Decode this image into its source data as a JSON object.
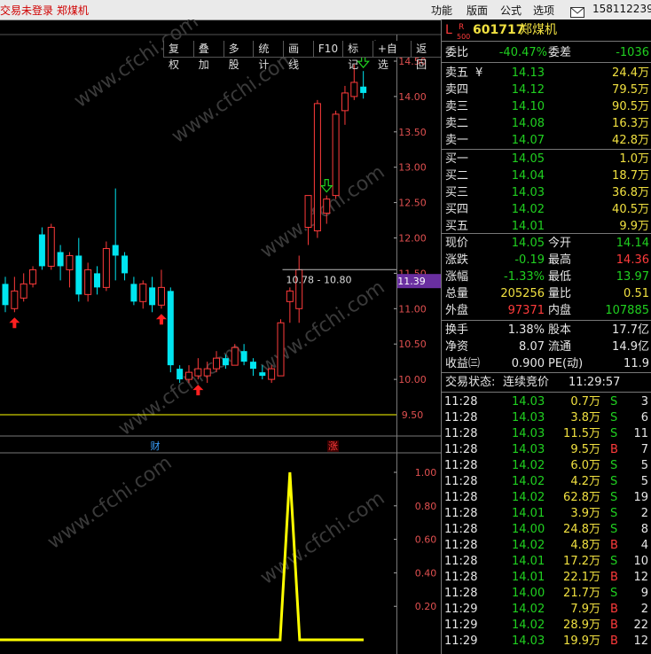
{
  "window": {
    "title": "交易未登录  郑煤机",
    "menu": [
      "功能",
      "版面",
      "公式",
      "选项"
    ],
    "mail_icon": "mail-icon",
    "account": "158112239"
  },
  "toolbar": [
    "复权",
    "叠加",
    "多股",
    "统计",
    "画线",
    "F10",
    "标记",
    "+自选",
    "返回"
  ],
  "chart": {
    "watermark": "www.cfchi.com",
    "price_axis": [
      "14.50",
      "14.00",
      "13.50",
      "13.00",
      "12.50",
      "12.00",
      "11.50",
      "11.00",
      "10.50",
      "10.00",
      "9.50"
    ],
    "current_price_tag": "11.39",
    "range_label": "10.78 - 10.80",
    "markers": [
      "财",
      "涨"
    ],
    "indicator_axis": [
      "1.00",
      "0.80",
      "0.60",
      "0.40",
      "0.20"
    ],
    "colors": {
      "up": "#ff3b3b",
      "down": "#00e5f0",
      "signal_up": "#ff2020",
      "signal_down": "#20d020",
      "line": "#ffff00",
      "level": "#ffff00"
    }
  },
  "stock": {
    "prefix": "L",
    "badge_top": "R",
    "badge_bottom": "500",
    "code": "601717",
    "name": "郑煤机"
  },
  "quote": {
    "weibi_label": "委比",
    "weibi": "-40.47%",
    "weicha_label": "委差",
    "weicha": "-1036",
    "asks": [
      {
        "label": "卖五",
        "flag": "¥",
        "price": "14.13",
        "vol": "24.4万"
      },
      {
        "label": "卖四",
        "flag": "",
        "price": "14.12",
        "vol": "79.5万"
      },
      {
        "label": "卖三",
        "flag": "",
        "price": "14.10",
        "vol": "90.5万"
      },
      {
        "label": "卖二",
        "flag": "",
        "price": "14.08",
        "vol": "16.3万"
      },
      {
        "label": "卖一",
        "flag": "",
        "price": "14.07",
        "vol": "42.8万"
      }
    ],
    "bids": [
      {
        "label": "买一",
        "price": "14.05",
        "vol": "1.0万"
      },
      {
        "label": "买二",
        "price": "14.04",
        "vol": "18.7万"
      },
      {
        "label": "买三",
        "price": "14.03",
        "vol": "36.8万"
      },
      {
        "label": "买四",
        "price": "14.02",
        "vol": "40.5万"
      },
      {
        "label": "买五",
        "price": "14.01",
        "vol": "9.9万"
      }
    ],
    "stats": [
      {
        "l1": "现价",
        "v1": "14.05",
        "c1": "green",
        "l2": "今开",
        "v2": "14.14",
        "c2": "green"
      },
      {
        "l1": "涨跌",
        "v1": "-0.19",
        "c1": "green",
        "l2": "最高",
        "v2": "14.36",
        "c2": "red"
      },
      {
        "l1": "涨幅",
        "v1": "-1.33%",
        "c1": "green",
        "l2": "最低",
        "v2": "13.97",
        "c2": "green"
      },
      {
        "l1": "总量",
        "v1": "205256",
        "c1": "yellow",
        "l2": "量比",
        "v2": "0.51",
        "c2": "yellow"
      },
      {
        "l1": "外盘",
        "v1": "97371",
        "c1": "red",
        "l2": "内盘",
        "v2": "107885",
        "c2": "green"
      }
    ],
    "fin": [
      {
        "l1": "换手",
        "v1": "1.38%",
        "l2": "股本",
        "v2": "17.7亿"
      },
      {
        "l1": "净资",
        "v1": "8.07",
        "l2": "流通",
        "v2": "14.9亿"
      },
      {
        "l1": "收益㈢",
        "v1": "0.900",
        "l2": "PE(动)",
        "v2": "11.9"
      }
    ],
    "status_label": "交易状态:",
    "status_value": "连续竞价",
    "status_time": "11:29:57"
  },
  "ticks": [
    {
      "time": "11:28",
      "price": "14.03",
      "vol": "0.7万",
      "side": "S",
      "n": "3"
    },
    {
      "time": "11:28",
      "price": "14.03",
      "vol": "3.8万",
      "side": "S",
      "n": "6"
    },
    {
      "time": "11:28",
      "price": "14.03",
      "vol": "11.5万",
      "side": "S",
      "n": "11"
    },
    {
      "time": "11:28",
      "price": "14.03",
      "vol": "9.5万",
      "side": "B",
      "n": "7"
    },
    {
      "time": "11:28",
      "price": "14.02",
      "vol": "6.0万",
      "side": "S",
      "n": "5"
    },
    {
      "time": "11:28",
      "price": "14.02",
      "vol": "4.2万",
      "side": "S",
      "n": "5"
    },
    {
      "time": "11:28",
      "price": "14.02",
      "vol": "62.8万",
      "side": "S",
      "n": "19"
    },
    {
      "time": "11:28",
      "price": "14.01",
      "vol": "3.9万",
      "side": "S",
      "n": "2"
    },
    {
      "time": "11:28",
      "price": "14.00",
      "vol": "24.8万",
      "side": "S",
      "n": "8"
    },
    {
      "time": "11:28",
      "price": "14.02",
      "vol": "4.8万",
      "side": "B",
      "n": "4"
    },
    {
      "time": "11:28",
      "price": "14.01",
      "vol": "17.2万",
      "side": "S",
      "n": "10"
    },
    {
      "time": "11:28",
      "price": "14.01",
      "vol": "22.1万",
      "side": "B",
      "n": "12"
    },
    {
      "time": "11:28",
      "price": "14.00",
      "vol": "21.7万",
      "side": "S",
      "n": "9"
    },
    {
      "time": "11:29",
      "price": "14.02",
      "vol": "7.9万",
      "side": "B",
      "n": "2"
    },
    {
      "time": "11:29",
      "price": "14.02",
      "vol": "28.9万",
      "side": "B",
      "n": "22"
    },
    {
      "time": "11:29",
      "price": "14.03",
      "vol": "19.9万",
      "side": "B",
      "n": "12"
    }
  ],
  "candles": [
    {
      "o": 11.35,
      "c": 11.05,
      "h": 11.45,
      "l": 10.95
    },
    {
      "o": 11.0,
      "c": 11.25,
      "h": 11.45,
      "l": 10.95
    },
    {
      "o": 11.15,
      "c": 11.35,
      "h": 11.5,
      "l": 11.1
    },
    {
      "o": 11.35,
      "c": 11.55,
      "h": 11.6,
      "l": 11.3
    },
    {
      "o": 12.05,
      "c": 11.6,
      "h": 12.15,
      "l": 11.55
    },
    {
      "o": 11.6,
      "c": 12.15,
      "h": 12.2,
      "l": 11.55
    },
    {
      "o": 11.8,
      "c": 11.6,
      "h": 11.9,
      "l": 11.4
    },
    {
      "o": 11.55,
      "c": 11.75,
      "h": 11.8,
      "l": 11.3
    },
    {
      "o": 11.75,
      "c": 11.2,
      "h": 12.0,
      "l": 11.1
    },
    {
      "o": 11.2,
      "c": 11.55,
      "h": 11.65,
      "l": 11.1
    },
    {
      "o": 11.5,
      "c": 11.3,
      "h": 11.6,
      "l": 11.2
    },
    {
      "o": 11.3,
      "c": 11.85,
      "h": 11.95,
      "l": 11.25
    },
    {
      "o": 11.9,
      "c": 11.75,
      "h": 12.7,
      "l": 11.4
    },
    {
      "o": 11.75,
      "c": 11.5,
      "h": 11.8,
      "l": 11.4
    },
    {
      "o": 11.35,
      "c": 11.1,
      "h": 11.45,
      "l": 11.05
    },
    {
      "o": 11.1,
      "c": 11.35,
      "h": 11.4,
      "l": 11.0
    },
    {
      "o": 11.3,
      "c": 11.05,
      "h": 11.45,
      "l": 10.95
    },
    {
      "o": 11.05,
      "c": 11.3,
      "h": 11.55,
      "l": 11.0
    },
    {
      "o": 11.25,
      "c": 10.2,
      "h": 11.3,
      "l": 10.1
    },
    {
      "o": 10.15,
      "c": 10.0,
      "h": 10.2,
      "l": 9.95
    },
    {
      "o": 10.0,
      "c": 10.1,
      "h": 10.2,
      "l": 9.95
    },
    {
      "o": 10.05,
      "c": 10.15,
      "h": 10.3,
      "l": 10.0
    },
    {
      "o": 10.05,
      "c": 10.15,
      "h": 10.25,
      "l": 9.95
    },
    {
      "o": 10.15,
      "c": 10.3,
      "h": 10.4,
      "l": 10.1
    },
    {
      "o": 10.3,
      "c": 10.2,
      "h": 10.35,
      "l": 10.15
    },
    {
      "o": 10.2,
      "c": 10.45,
      "h": 10.5,
      "l": 10.2
    },
    {
      "o": 10.4,
      "c": 10.25,
      "h": 10.5,
      "l": 10.2
    },
    {
      "o": 10.25,
      "c": 10.15,
      "h": 10.3,
      "l": 10.05
    },
    {
      "o": 10.1,
      "c": 10.05,
      "h": 10.2,
      "l": 10.0
    },
    {
      "o": 10.0,
      "c": 10.15,
      "h": 10.2,
      "l": 9.95
    },
    {
      "o": 10.05,
      "c": 10.8,
      "h": 10.85,
      "l": 10.05
    },
    {
      "o": 11.1,
      "c": 11.25,
      "h": 11.3,
      "l": 10.8
    },
    {
      "o": 11.0,
      "c": 11.55,
      "h": 11.75,
      "l": 10.8
    },
    {
      "o": 12.15,
      "c": 12.6,
      "h": 12.6,
      "l": 11.9
    },
    {
      "o": 12.1,
      "c": 13.9,
      "h": 13.95,
      "l": 12.0
    },
    {
      "o": 12.35,
      "c": 12.55,
      "h": 12.6,
      "l": 12.2
    },
    {
      "o": 12.6,
      "c": 13.75,
      "h": 13.8,
      "l": 12.55
    },
    {
      "o": 13.8,
      "c": 14.05,
      "h": 14.15,
      "l": 13.6
    },
    {
      "o": 14.0,
      "c": 14.2,
      "h": 14.45,
      "l": 13.95
    },
    {
      "o": 14.14,
      "c": 14.05,
      "h": 14.36,
      "l": 13.97
    }
  ],
  "signals": {
    "up_index": [
      1,
      17,
      21
    ],
    "down_index": [
      35,
      39
    ]
  },
  "indicator": {
    "spike_index": 31,
    "spike_value": 1.0
  }
}
